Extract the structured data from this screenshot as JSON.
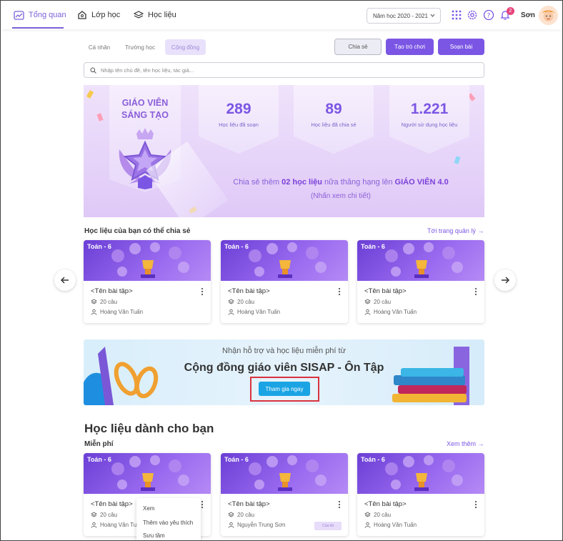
{
  "nav": {
    "items": [
      {
        "label": "Tổng quan",
        "icon": "chart-icon",
        "active": true
      },
      {
        "label": "Lớp học",
        "icon": "house-icon",
        "active": false
      },
      {
        "label": "Học liệu",
        "icon": "layers-icon",
        "active": false
      }
    ],
    "year_select": "Năm học 2020 - 2021",
    "notification_count": "2",
    "user_name": "Sơn"
  },
  "subtabs": [
    "Cá nhân",
    "Trường học",
    "Cộng đồng"
  ],
  "actions": {
    "share": "Chia sẻ",
    "game": "Tạo trò chơi",
    "new_lesson": "Soạn bài"
  },
  "search": {
    "placeholder": "Nhập tên chủ đề, tên học liệu, tác giả..."
  },
  "hero": {
    "rank_title_1": "GIÁO VIÊN",
    "rank_title_2": "SÁNG TẠO",
    "stats": [
      {
        "value": "289",
        "label": "Học liệu đã soạn"
      },
      {
        "value": "89",
        "label": "Học liệu đã chia sẻ"
      },
      {
        "value": "1.221",
        "label": "Người sử dụng học liệu"
      }
    ],
    "msg_prefix": "Chia sẻ thêm ",
    "msg_count": "02 học liệu",
    "msg_middle": " nữa thăng hạng lên ",
    "msg_rank": "GIÁO VIÊN 4.0",
    "msg_sub": "(Nhấn xem chi tiết)"
  },
  "shareable": {
    "title": "Học liệu của bạn có thể chia sẻ",
    "link": "Tới trang quản lý →",
    "cards": [
      {
        "tag": "Toán - 6",
        "title": "<Tên bài tập>",
        "count": "20 câu",
        "author": "Hoàng Văn Tuấn"
      },
      {
        "tag": "Toán - 6",
        "title": "<Tên bài tập>",
        "count": "20 câu",
        "author": "Hoàng Văn Tuấn"
      },
      {
        "tag": "Toán - 6",
        "title": "<Tên bài tập>",
        "count": "20 câu",
        "author": "Hoàng Văn Tuấn"
      }
    ]
  },
  "promo": {
    "subtitle": "Nhận hỗ trợ và học liệu miễn phí từ",
    "title": "Cộng đồng giáo viên SISAP - Ôn Tập",
    "button": "Tham gia ngay"
  },
  "for_you": {
    "title": "Học liệu dành cho bạn",
    "section": "Miễn phí",
    "link": "Xem thêm →",
    "cards": [
      {
        "tag": "Toán - 6",
        "title": "<Tên bài tập>",
        "count": "20 câu",
        "author": "Hoàng Văn Tu"
      },
      {
        "tag": "Toán - 6",
        "title": "<Tên bài tập>",
        "count": "20 câu",
        "author": "Nguyễn Trung Sơn",
        "chip": "Của tôi"
      },
      {
        "tag": "Toán - 6",
        "title": "<Tên bài tập>",
        "count": "20 câu",
        "author": "Hoàng Văn Tuấn"
      }
    ]
  },
  "context_menu": [
    "Xem",
    "Thêm vào yêu thích",
    "Sưu tầm"
  ],
  "colors": {
    "accent": "#7b56e4",
    "promo_button": "#1aa4e4",
    "highlight_frame": "#d9333f",
    "badge": "#e6457c"
  }
}
